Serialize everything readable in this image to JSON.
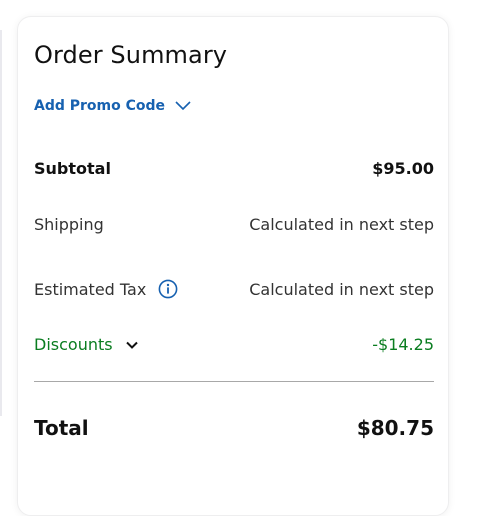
{
  "summary": {
    "title": "Order Summary",
    "promo_label": "Add Promo Code",
    "subtotal": {
      "label": "Subtotal",
      "value": "$95.00"
    },
    "shipping": {
      "label": "Shipping",
      "value": "Calculated in next step"
    },
    "tax": {
      "label": "Estimated Tax",
      "value": "Calculated in next step"
    },
    "discounts": {
      "label": "Discounts",
      "value": "-$14.25"
    },
    "total": {
      "label": "Total",
      "value": "$80.75"
    }
  },
  "icons": {
    "promo_chevron": "chevron-down-icon",
    "tax_info": "info-icon",
    "discounts_chevron": "chevron-down-icon"
  },
  "colors": {
    "link_blue": "#1761b0",
    "discount_green": "#0a7d20",
    "divider": "#a8a8a8"
  }
}
